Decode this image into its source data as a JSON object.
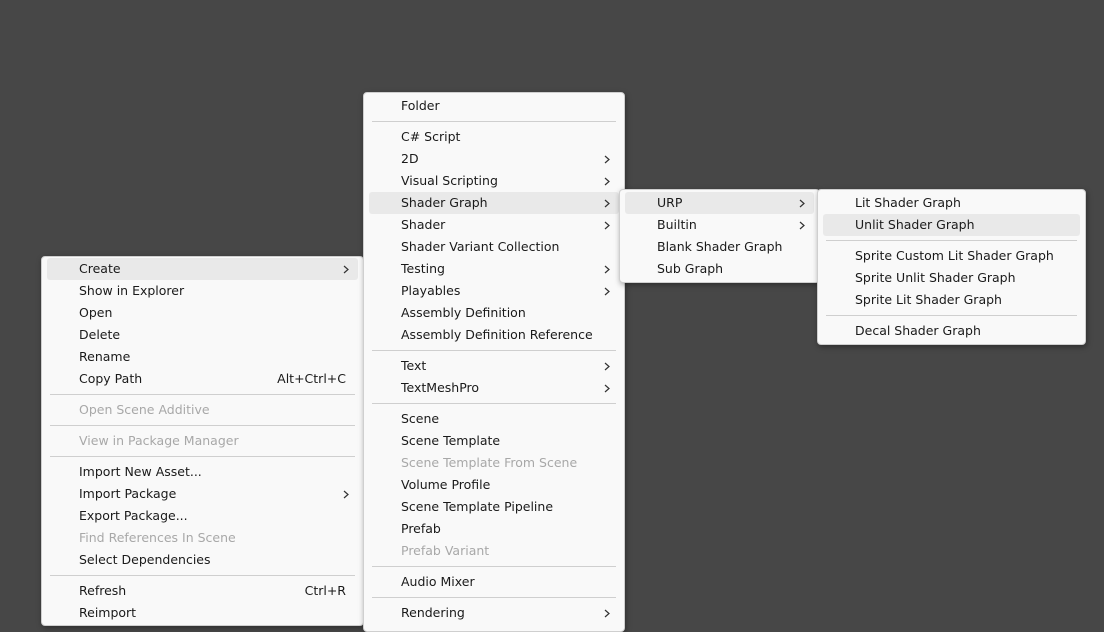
{
  "project_menu": {
    "create": "Create",
    "show_in_explorer": "Show in Explorer",
    "open": "Open",
    "delete": "Delete",
    "rename": "Rename",
    "copy_path": "Copy Path",
    "copy_path_shortcut": "Alt+Ctrl+C",
    "open_scene_additive": "Open Scene Additive",
    "view_in_package_manager": "View in Package Manager",
    "import_new_asset": "Import New Asset...",
    "import_package": "Import Package",
    "export_package": "Export Package...",
    "find_references": "Find References In Scene",
    "select_dependencies": "Select Dependencies",
    "refresh": "Refresh",
    "refresh_shortcut": "Ctrl+R",
    "reimport": "Reimport"
  },
  "create_menu": {
    "folder": "Folder",
    "csharp_script": "C# Script",
    "twod": "2D",
    "visual_scripting": "Visual Scripting",
    "shader_graph": "Shader Graph",
    "shader": "Shader",
    "shader_variant_collection": "Shader Variant Collection",
    "testing": "Testing",
    "playables": "Playables",
    "assembly_definition": "Assembly Definition",
    "assembly_definition_reference": "Assembly Definition Reference",
    "text": "Text",
    "textmeshpro": "TextMeshPro",
    "scene": "Scene",
    "scene_template": "Scene Template",
    "scene_template_from_scene": "Scene Template From Scene",
    "volume_profile": "Volume Profile",
    "scene_template_pipeline": "Scene Template Pipeline",
    "prefab": "Prefab",
    "prefab_variant": "Prefab Variant",
    "audio_mixer": "Audio Mixer",
    "rendering": "Rendering"
  },
  "shadergraph_menu": {
    "urp": "URP",
    "builtin": "Builtin",
    "blank_shader_graph": "Blank Shader Graph",
    "sub_graph": "Sub Graph"
  },
  "urp_menu": {
    "lit_shader_graph": "Lit Shader Graph",
    "unlit_shader_graph": "Unlit Shader Graph",
    "sprite_custom_lit": "Sprite Custom Lit Shader Graph",
    "sprite_unlit": "Sprite Unlit Shader Graph",
    "sprite_lit": "Sprite Lit Shader Graph",
    "decal_shader_graph": "Decal Shader Graph"
  },
  "colors": {
    "background": "#474747",
    "menu_bg": "#f9f9f9",
    "highlight": "#e9e9e9",
    "disabled_text": "#a8a8a8"
  }
}
